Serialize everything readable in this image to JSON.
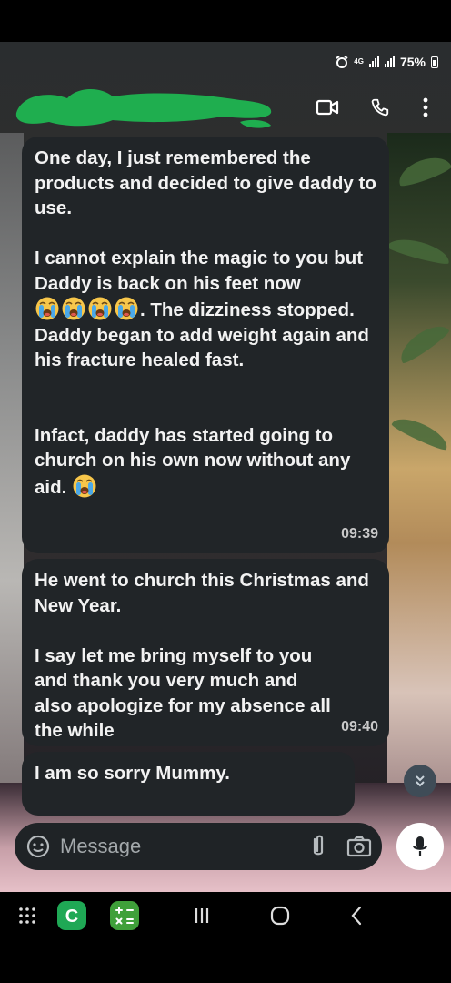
{
  "status_bar": {
    "network": "4G",
    "battery": "75%"
  },
  "header": {
    "contact_name": ""
  },
  "messages": [
    {
      "paragraphs": [
        "One day, I just remembered the products and decided to give daddy to use.",
        "I cannot explain the magic to you but Daddy is back on his feet now",
        ". The dizziness stopped. Daddy began to add weight again and his fracture healed fast.",
        "Infact, daddy has started going to church on his own now without any aid."
      ],
      "time": "09:39"
    },
    {
      "paragraphs": [
        "He went to church this Christmas and New Year.",
        "I say let me bring myself to you and thank you very much and also apologize for my absence all the while"
      ],
      "time": "09:40"
    },
    {
      "paragraphs": [
        "I am so sorry Mummy."
      ],
      "time": ""
    }
  ],
  "composer": {
    "placeholder": "Message"
  },
  "icons": {
    "emoji": "crying-face-emoji",
    "header": [
      "video-call-icon",
      "phone-icon",
      "more-vertical-icon"
    ],
    "composer": [
      "sticker-icon",
      "paperclip-icon",
      "camera-icon",
      "mic-icon"
    ],
    "nav": [
      "app-grid-icon",
      "c-app-icon",
      "calculator-icon",
      "recent-apps-icon",
      "home-icon",
      "back-icon"
    ]
  },
  "colors": {
    "bubble": "#212528",
    "text": "#f2f2f2",
    "accent_green": "#1fa855",
    "scroll_button": "#3f4c57"
  }
}
